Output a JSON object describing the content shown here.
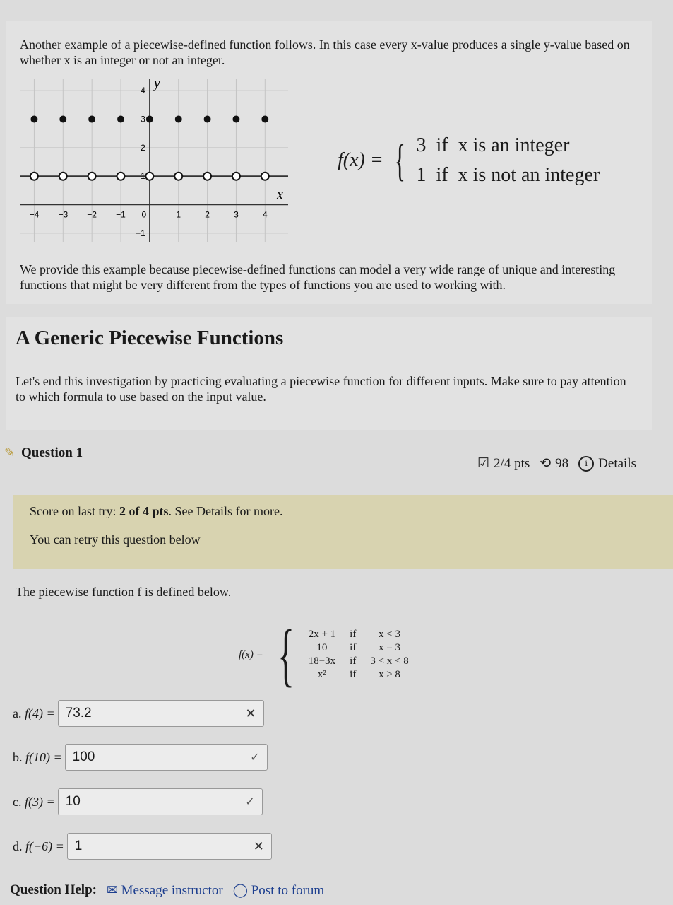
{
  "intro": "Another example of a piecewise-defined function follows. In this case every x-value produces a single y-value based on whether x is an integer or not an integer.",
  "chart_data": {
    "type": "scatter",
    "xlabel": "x",
    "ylabel": "y",
    "xlim": [
      -4.5,
      4.8
    ],
    "ylim": [
      -1.3,
      4.4
    ],
    "x_ticks": [
      "-4",
      "-3",
      "-2",
      "-1",
      "0",
      "1",
      "2",
      "3",
      "4"
    ],
    "y_ticks": [
      "4",
      "3",
      "2",
      "1",
      "-1"
    ],
    "grid": true,
    "series": [
      {
        "marker": "closed",
        "x": [
          -4,
          -3,
          -2,
          -1,
          0,
          1,
          2,
          3,
          4
        ],
        "y": [
          3,
          3,
          3,
          3,
          3,
          3,
          3,
          3,
          3
        ]
      },
      {
        "marker": "line-with-open-circles",
        "y": 1,
        "holes_x": [
          -4,
          -3,
          -2,
          -1,
          0,
          1,
          2,
          3,
          4
        ]
      }
    ]
  },
  "formula1": {
    "lhs": "f(x) =",
    "cases": [
      [
        "3",
        "if",
        "x is an integer"
      ],
      [
        "1",
        "if",
        "x is not an integer"
      ]
    ]
  },
  "para2": "We provide this example because piecewise-defined functions can model a very wide range of unique and interesting functions that might be very different from the types of functions you are used to working with.",
  "section_title": "A Generic Piecewise Functions",
  "section_text": "Let's end this investigation by practicing evaluating a piecewise function for different inputs. Make sure to pay attention to which formula to use based on the input value.",
  "question": {
    "title": "Question 1",
    "pts": "2/4 pts",
    "retries": "98",
    "details": "Details"
  },
  "score": {
    "prefix": "Score on last try: ",
    "bold": "2 of 4 pts",
    "suffix": ". See Details for more.",
    "retry": "You can retry this question below"
  },
  "prompt": "The piecewise function f is defined below.",
  "formula2": {
    "lhs": "f(x) =",
    "cases": [
      [
        "2x + 1",
        "if",
        "x < 3"
      ],
      [
        "10",
        "if",
        "x = 3"
      ],
      [
        "18−3x",
        "if",
        "3 < x < 8"
      ],
      [
        "x²",
        "if",
        "x ≥ 8"
      ]
    ]
  },
  "answers": [
    {
      "label": "a.",
      "expr": "f(4) =",
      "value": "73.2",
      "status": "incorrect"
    },
    {
      "label": "b.",
      "expr": "f(10) =",
      "value": "100",
      "status": "correct"
    },
    {
      "label": "c.",
      "expr": "f(3) =",
      "value": "10",
      "status": "correct"
    },
    {
      "label": "d.",
      "expr": "f(−6) =",
      "value": "1",
      "status": "incorrect"
    }
  ],
  "help": {
    "label": "Question Help:",
    "message": "Message instructor",
    "forum": "Post to forum"
  }
}
